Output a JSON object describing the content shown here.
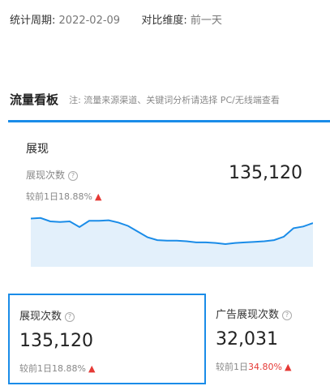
{
  "filters": {
    "period_label": "统计周期:",
    "period_value": "2022-02-09",
    "compare_label": "对比维度:",
    "compare_value": "前一天"
  },
  "section": {
    "title": "流量看板",
    "note": "注: 流量来源渠道、关键词分析请选择 PC/无线端查看"
  },
  "chart_card": {
    "title": "展现",
    "metric_label": "展现次数",
    "metric_value": "135,120",
    "compare_text": "较前1日18.88%",
    "arrow": "up"
  },
  "cards": [
    {
      "label": "展现次数",
      "value": "135,120",
      "compare_prefix": "较前1日",
      "compare_pct": "18.88%",
      "selected": true,
      "pct_color": "#888888"
    },
    {
      "label": "广告展现次数",
      "value": "32,031",
      "compare_prefix": "较前1日",
      "compare_pct": "34.80%",
      "selected": false,
      "pct_color": "#e53935"
    }
  ],
  "colors": {
    "accent": "#1a8ce8",
    "area_fill": "#e3f0fb",
    "up_arrow": "#e53935"
  },
  "chart_data": {
    "type": "area",
    "series": [
      {
        "values": [
          85,
          86,
          80,
          79,
          80,
          70,
          81,
          81,
          82,
          78,
          72,
          62,
          52,
          47,
          46,
          46,
          45,
          43,
          43,
          42,
          40,
          42,
          43,
          44,
          45,
          47,
          53,
          68,
          71,
          77
        ]
      }
    ],
    "grid": false,
    "legend": "none"
  }
}
